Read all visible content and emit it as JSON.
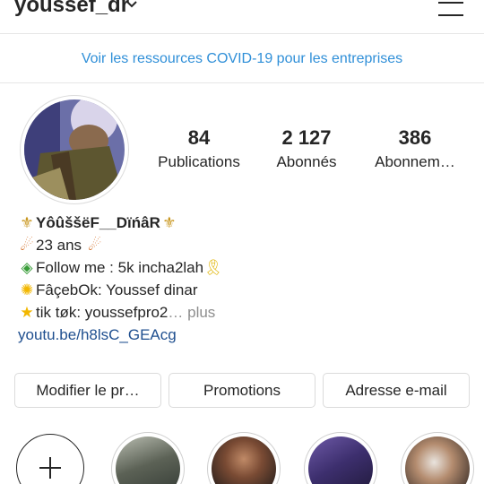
{
  "header": {
    "username": "youssef_dr"
  },
  "banner": {
    "text": "Voir les ressources COVID-19 pour les entreprises"
  },
  "stats": [
    {
      "number": "84",
      "label": "Publications"
    },
    {
      "number": "2 127",
      "label": "Abonnés"
    },
    {
      "number": "386",
      "label": "Abonnem…"
    }
  ],
  "bio": {
    "name": "YôûššëF__DïńâR",
    "name_icon": "fleur-de-lis-icon",
    "lines": [
      {
        "icon": "comet-icon",
        "text": "23 ans"
      },
      {
        "icon": "beginner-icon",
        "text": "Follow me : 5k incha2lah"
      },
      {
        "icon": "sparkle-icon",
        "text": "FâçebOk: Youssef dinar"
      },
      {
        "icon": "star-icon",
        "text": "tik tøk: youssefpro2"
      }
    ],
    "more": "… plus",
    "link": "youtu.be/h8lsC_GEAcg"
  },
  "buttons": {
    "edit": "Modifier le pr…",
    "promotions": "Promotions",
    "email": "Adresse e-mail"
  },
  "highlights": {
    "new_icon": "plus-icon",
    "count": 4
  },
  "colors": {
    "link": "#2f8fd8",
    "text": "#262626",
    "muted": "#8e8e8e",
    "border": "#dbdbdb"
  }
}
